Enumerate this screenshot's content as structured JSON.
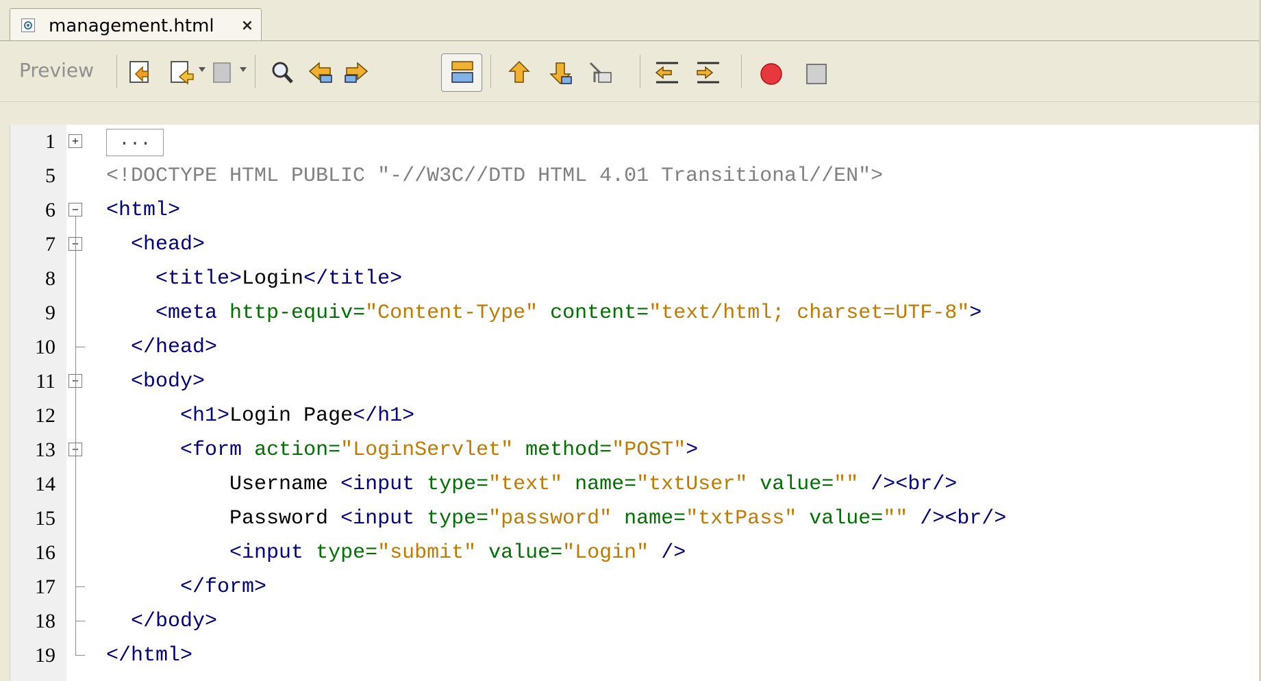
{
  "tab": {
    "title": "management.html",
    "close": "×"
  },
  "toolbar": {
    "preview_label": "Preview"
  },
  "colors": {
    "tag": "#000080",
    "attr": "#007000",
    "value": "#c07a00",
    "doctype": "#808080"
  },
  "editor": {
    "collapsed_label": "...",
    "lines": [
      {
        "num": "1",
        "fold": "+",
        "tokens": []
      },
      {
        "num": "5",
        "tokens": [
          [
            "doc",
            "<!DOCTYPE HTML PUBLIC \"-//W3C//DTD HTML 4.01 Transitional//EN\">"
          ]
        ]
      },
      {
        "num": "6",
        "fold": "-",
        "tokens": [
          [
            "tag",
            "<html>"
          ]
        ]
      },
      {
        "num": "7",
        "fold": "-",
        "tokens": [
          [
            "text",
            "  "
          ],
          [
            "tag",
            "<head>"
          ]
        ]
      },
      {
        "num": "8",
        "tokens": [
          [
            "text",
            "    "
          ],
          [
            "tag",
            "<title>"
          ],
          [
            "text",
            "Login"
          ],
          [
            "tag",
            "</title>"
          ]
        ]
      },
      {
        "num": "9",
        "tokens": [
          [
            "text",
            "    "
          ],
          [
            "tag",
            "<meta "
          ],
          [
            "attr",
            "http-equiv="
          ],
          [
            "val",
            "\"Content-Type\""
          ],
          [
            "text",
            " "
          ],
          [
            "attr",
            "content="
          ],
          [
            "val",
            "\"text/html; charset=UTF-8\""
          ],
          [
            "tag",
            ">"
          ]
        ]
      },
      {
        "num": "10",
        "end": true,
        "tokens": [
          [
            "text",
            "  "
          ],
          [
            "tag",
            "</head>"
          ]
        ]
      },
      {
        "num": "11",
        "fold": "-",
        "tokens": [
          [
            "text",
            "  "
          ],
          [
            "tag",
            "<body>"
          ]
        ]
      },
      {
        "num": "12",
        "tokens": [
          [
            "text",
            "      "
          ],
          [
            "tag",
            "<h1>"
          ],
          [
            "text",
            "Login Page"
          ],
          [
            "tag",
            "</h1>"
          ]
        ]
      },
      {
        "num": "13",
        "fold": "-",
        "tokens": [
          [
            "text",
            "      "
          ],
          [
            "tag",
            "<form "
          ],
          [
            "attr",
            "action="
          ],
          [
            "val",
            "\"LoginServlet\""
          ],
          [
            "text",
            " "
          ],
          [
            "attr",
            "method="
          ],
          [
            "val",
            "\"POST\""
          ],
          [
            "tag",
            ">"
          ]
        ]
      },
      {
        "num": "14",
        "tokens": [
          [
            "text",
            "          Username "
          ],
          [
            "tag",
            "<input "
          ],
          [
            "attr",
            "type="
          ],
          [
            "val",
            "\"text\""
          ],
          [
            "text",
            " "
          ],
          [
            "attr",
            "name="
          ],
          [
            "val",
            "\"txtUser\""
          ],
          [
            "text",
            " "
          ],
          [
            "attr",
            "value="
          ],
          [
            "val",
            "\"\""
          ],
          [
            "text",
            " "
          ],
          [
            "tag",
            "/><br/>"
          ]
        ]
      },
      {
        "num": "15",
        "tokens": [
          [
            "text",
            "          Password "
          ],
          [
            "tag",
            "<input "
          ],
          [
            "attr",
            "type="
          ],
          [
            "val",
            "\"password\""
          ],
          [
            "text",
            " "
          ],
          [
            "attr",
            "name="
          ],
          [
            "val",
            "\"txtPass\""
          ],
          [
            "text",
            " "
          ],
          [
            "attr",
            "value="
          ],
          [
            "val",
            "\"\""
          ],
          [
            "text",
            " "
          ],
          [
            "tag",
            "/><br/>"
          ]
        ]
      },
      {
        "num": "16",
        "tokens": [
          [
            "text",
            "          "
          ],
          [
            "tag",
            "<input "
          ],
          [
            "attr",
            "type="
          ],
          [
            "val",
            "\"submit\""
          ],
          [
            "text",
            " "
          ],
          [
            "attr",
            "value="
          ],
          [
            "val",
            "\"Login\""
          ],
          [
            "text",
            " "
          ],
          [
            "tag",
            "/>"
          ]
        ]
      },
      {
        "num": "17",
        "end": true,
        "tokens": [
          [
            "text",
            "      "
          ],
          [
            "tag",
            "</form>"
          ]
        ]
      },
      {
        "num": "18",
        "end": true,
        "tokens": [
          [
            "text",
            "  "
          ],
          [
            "tag",
            "</body>"
          ]
        ]
      },
      {
        "num": "19",
        "end": true,
        "tokens": [
          [
            "tag",
            "</html>"
          ]
        ]
      }
    ]
  }
}
